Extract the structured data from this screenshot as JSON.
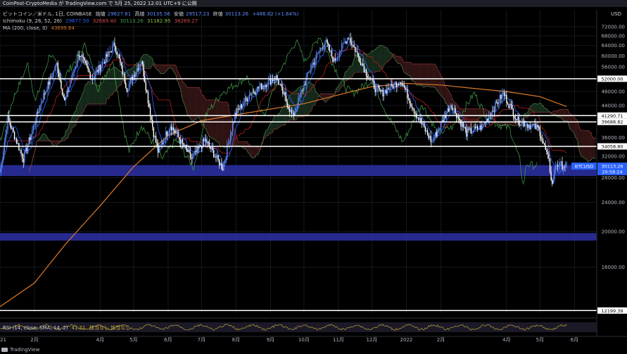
{
  "header": {
    "text": "CoinPost-CryptoMedia が TradingView.com で 5月 25, 2022 12:01 UTC+9 に公開"
  },
  "legend": {
    "symbol": "ビットコイン／米ドル, 1日, COINBASE",
    "open_label": "始値",
    "open": "29627.61",
    "high_label": "高値",
    "high": "30135.56",
    "low_label": "安値",
    "low": "29517.23",
    "close_label": "終値",
    "close": "30113.26",
    "change": "+486.82 (+1.64%)",
    "ichimoku_label": "Ichimoku (9, 26, 52, 26)",
    "ichimoku_values": [
      "29677.50",
      "32689.40",
      "30113.26",
      "31182.95",
      "36269.27"
    ],
    "ma_label": "MA (200, close, 0)",
    "ma_value": "43699.64"
  },
  "rsi": {
    "label": "RSI (14, close, SMA, 14, 2)",
    "value": "41.51",
    "extra": "該当なし  該当なし"
  },
  "branding": {
    "text": "TradingView"
  },
  "colors": {
    "bg": "#000000",
    "candles": "#ffffff",
    "candle_blue": "#5b8cff",
    "conversion": "#2962ff",
    "base": "#b71c1c",
    "lagging": "#43a047",
    "ma200": "#d87a2a",
    "cloud_bear": "#3a1717",
    "cloud_bull": "#1a3320",
    "zone": "#2a2f9e",
    "level_line": "#ffffff",
    "price_tag": "#2962ff",
    "rsi_line": "#b7a23a"
  },
  "chart_data": {
    "type": "candlestick",
    "title": "ビットコイン／米ドル, 1日, COINBASE",
    "currency": "USD",
    "y_scale": "log",
    "ylim": [
      12000,
      80000
    ],
    "y_ticks": [
      16000,
      20000,
      24000,
      28000,
      32000,
      36000,
      44000,
      48000,
      56000,
      60000,
      64000,
      68000,
      72000
    ],
    "x_labels": [
      {
        "label": "2021",
        "date": "2021-01-01"
      },
      {
        "label": "2月",
        "date": "2021-02-01"
      },
      {
        "label": "4月",
        "date": "2021-04-01"
      },
      {
        "label": "5月",
        "date": "2021-05-01"
      },
      {
        "label": "6月",
        "date": "2021-06-01"
      },
      {
        "label": "7月",
        "date": "2021-07-01"
      },
      {
        "label": "8月",
        "date": "2021-08-01"
      },
      {
        "label": "9月",
        "date": "2021-09-01"
      },
      {
        "label": "10月",
        "date": "2021-10-01"
      },
      {
        "label": "11月",
        "date": "2021-11-01"
      },
      {
        "label": "12月",
        "date": "2021-12-01"
      },
      {
        "label": "2022",
        "date": "2022-01-01"
      },
      {
        "label": "2月",
        "date": "2022-02-01"
      },
      {
        "label": "4月",
        "date": "2022-04-01"
      },
      {
        "label": "5月",
        "date": "2022-05-01"
      },
      {
        "label": "6月",
        "date": "2022-06-01"
      }
    ],
    "x_range": [
      "2021-01-01",
      "2022-06-21"
    ],
    "levels": [
      {
        "price": 52000,
        "label": "52000.00"
      },
      {
        "price": 41290.71,
        "label": "41290.71"
      },
      {
        "price": 39688.82,
        "label": "39688.82"
      },
      {
        "price": 34058.8,
        "label": "34058.80"
      },
      {
        "price": 12199.39,
        "label": "12199.39"
      }
    ],
    "zones": [
      {
        "from": 28300,
        "to": 30300
      },
      {
        "from": 18900,
        "to": 19800
      }
    ],
    "price_tag": {
      "symbol": "BTCUSD",
      "price": 30113.26,
      "label": "30113.26",
      "countdown": "20:58:24"
    },
    "price_path": [
      {
        "date": "2021-01-01",
        "price": 29000
      },
      {
        "date": "2021-01-08",
        "price": 40500
      },
      {
        "date": "2021-01-22",
        "price": 31500
      },
      {
        "date": "2021-02-08",
        "price": 46000
      },
      {
        "date": "2021-02-21",
        "price": 57000
      },
      {
        "date": "2021-02-28",
        "price": 45000
      },
      {
        "date": "2021-03-13",
        "price": 61000
      },
      {
        "date": "2021-03-25",
        "price": 52000
      },
      {
        "date": "2021-04-14",
        "price": 64500
      },
      {
        "date": "2021-04-25",
        "price": 49000
      },
      {
        "date": "2021-05-08",
        "price": 58500
      },
      {
        "date": "2021-05-19",
        "price": 37000
      },
      {
        "date": "2021-05-23",
        "price": 33000
      },
      {
        "date": "2021-06-03",
        "price": 39000
      },
      {
        "date": "2021-06-22",
        "price": 31500
      },
      {
        "date": "2021-07-04",
        "price": 35500
      },
      {
        "date": "2021-07-20",
        "price": 29800
      },
      {
        "date": "2021-07-31",
        "price": 41500
      },
      {
        "date": "2021-08-14",
        "price": 47500
      },
      {
        "date": "2021-08-23",
        "price": 49500
      },
      {
        "date": "2021-09-06",
        "price": 52500
      },
      {
        "date": "2021-09-21",
        "price": 41000
      },
      {
        "date": "2021-10-06",
        "price": 55000
      },
      {
        "date": "2021-10-20",
        "price": 66000
      },
      {
        "date": "2021-10-28",
        "price": 58000
      },
      {
        "date": "2021-11-10",
        "price": 68000
      },
      {
        "date": "2021-11-26",
        "price": 54000
      },
      {
        "date": "2021-12-04",
        "price": 49000
      },
      {
        "date": "2021-12-10",
        "price": 47500
      },
      {
        "date": "2021-12-27",
        "price": 51500
      },
      {
        "date": "2022-01-10",
        "price": 41500
      },
      {
        "date": "2022-01-24",
        "price": 35000
      },
      {
        "date": "2022-02-10",
        "price": 44500
      },
      {
        "date": "2022-02-24",
        "price": 37000
      },
      {
        "date": "2022-03-10",
        "price": 38500
      },
      {
        "date": "2022-03-29",
        "price": 47500
      },
      {
        "date": "2022-04-11",
        "price": 40000
      },
      {
        "date": "2022-04-30",
        "price": 38000
      },
      {
        "date": "2022-05-09",
        "price": 31000
      },
      {
        "date": "2022-05-12",
        "price": 26700
      },
      {
        "date": "2022-05-15",
        "price": 30500
      },
      {
        "date": "2022-05-25",
        "price": 30113
      }
    ],
    "ma200": [
      {
        "date": "2021-01-01",
        "price": 12500
      },
      {
        "date": "2021-02-01",
        "price": 14500
      },
      {
        "date": "2021-03-01",
        "price": 18500
      },
      {
        "date": "2021-04-01",
        "price": 23500
      },
      {
        "date": "2021-05-01",
        "price": 30000
      },
      {
        "date": "2021-06-01",
        "price": 36500
      },
      {
        "date": "2021-07-01",
        "price": 40000
      },
      {
        "date": "2021-08-01",
        "price": 41500
      },
      {
        "date": "2021-09-01",
        "price": 43000
      },
      {
        "date": "2021-10-01",
        "price": 44500
      },
      {
        "date": "2021-11-01",
        "price": 47000
      },
      {
        "date": "2021-12-01",
        "price": 49500
      },
      {
        "date": "2022-01-01",
        "price": 50500
      },
      {
        "date": "2022-02-01",
        "price": 50000
      },
      {
        "date": "2022-03-01",
        "price": 49000
      },
      {
        "date": "2022-04-01",
        "price": 48000
      },
      {
        "date": "2022-05-01",
        "price": 46500
      },
      {
        "date": "2022-05-25",
        "price": 43700
      }
    ]
  }
}
